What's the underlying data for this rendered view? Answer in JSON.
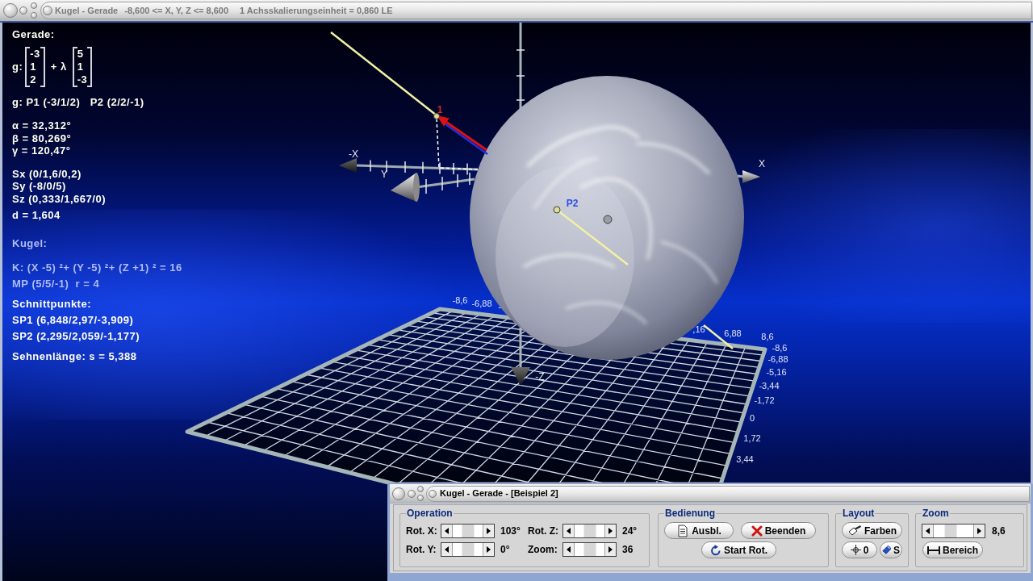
{
  "window": {
    "title_parts": [
      "Kugel - Gerade",
      "-8,600 <= X, Y, Z <= 8,600",
      "1 Achsskalierungseinheit = 0,860 LE"
    ]
  },
  "info_panel": {
    "blocks": [
      {
        "kind": "lines",
        "color": "#fffff0",
        "lines": [
          "Gerade:"
        ]
      },
      {
        "kind": "vector",
        "color": "#fffff0",
        "label": "g:",
        "base": [
          "-3",
          "1",
          "2"
        ],
        "operator": "+ λ",
        "direction": [
          "5",
          "1",
          "-3"
        ]
      },
      {
        "kind": "lines",
        "color": "#fffff0",
        "lines": [
          "g: P1 (-3/1/2)   P2 (2/2/-1)"
        ]
      },
      {
        "kind": "compact",
        "color": "#fffff0",
        "lines": [
          "α = 32,312°",
          "β = 80,269°",
          "γ = 120,47°"
        ]
      },
      {
        "kind": "compact",
        "color": "#fffff0",
        "lines": [
          "Sx (0/1,6/0,2)",
          "Sy (-8/0/5)",
          "Sz (0,333/1,667/0)"
        ]
      },
      {
        "kind": "lines",
        "color": "#fffff0",
        "lines": [
          "d = 1,604"
        ]
      },
      {
        "kind": "lines",
        "color": "#b0bcf4",
        "lines": [
          "Kugel:"
        ]
      },
      {
        "kind": "lines",
        "color": "#b0bcf4",
        "lines": [
          "K: (X -5) ²+ (Y -5) ²+ (Z +1) ² = 16",
          "MP (5/5/-1)  r = 4"
        ]
      },
      {
        "kind": "lines",
        "color": "#fffff0",
        "lines": [
          "Schnittpunkte:",
          "SP1 (6,848/2,97/-3,909)",
          "SP2 (2,295/2,059/-1,177)"
        ]
      },
      {
        "kind": "lines",
        "color": "#fffff0",
        "lines": [
          "Sehnenlänge: s = 5,388"
        ]
      }
    ]
  },
  "scene": {
    "axis_labels": [
      "-X",
      "X",
      "Y",
      "-Z"
    ],
    "point_labels": [
      {
        "text": "1",
        "color": "#e02424"
      },
      {
        "text": "P2",
        "color": "#2a4ee8"
      }
    ],
    "tick_labels": {
      "back_edge": [
        "-8,6",
        "-6,88",
        "-",
        ",16",
        "6,88",
        "8,6"
      ],
      "right_edge": [
        "-8,6",
        "-6,88",
        "-5,16",
        "-3,44",
        "-1,72",
        "0",
        "1,72",
        "3,44"
      ]
    }
  },
  "control_window": {
    "title": "Kugel - Gerade - [Beispiel 2]",
    "groups": [
      {
        "kind": "sliders",
        "title": "Operation",
        "sliders": [
          {
            "label": "Rot. X:",
            "value": "103°",
            "level": 0.5
          },
          {
            "label": "Rot. Z:",
            "value": "24°",
            "level": 0.5
          },
          {
            "label": "Rot. Y:",
            "value": "0°",
            "level": 0.5
          },
          {
            "label": "Zoom:",
            "value": "36",
            "level": 0.5
          }
        ]
      },
      {
        "kind": "buttons",
        "title": "Bedienung",
        "buttons": [
          {
            "label": "Ausbl."
          },
          {
            "label": "Beenden"
          },
          {
            "label": "Start Rot."
          }
        ]
      },
      {
        "kind": "buttons",
        "title": "Layout",
        "buttons": [
          {
            "label": "Farben"
          },
          {
            "label": "0"
          },
          {
            "label": "S"
          }
        ]
      },
      {
        "kind": "zoom",
        "title": "Zoom",
        "slider": {
          "value": "8,6",
          "level": 0.4
        },
        "buttons": [
          {
            "label": "Bereich"
          }
        ]
      }
    ]
  }
}
